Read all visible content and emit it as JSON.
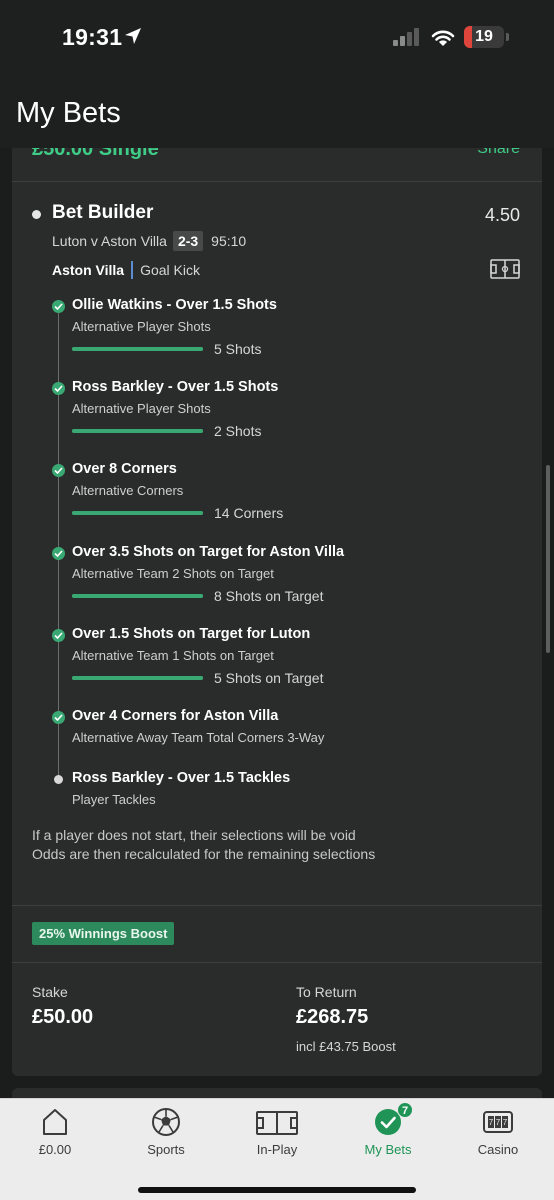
{
  "status": {
    "time": "19:31",
    "battery": "19"
  },
  "header": {
    "title": "My Bets"
  },
  "bet": {
    "type_label": "£50.00  Single",
    "share_label": "Share",
    "builder_title": "Bet Builder",
    "odds": "4.50",
    "match": "Luton v Aston Villa",
    "score": "2-3",
    "clock": "95:10",
    "event_team": "Aston Villa",
    "event_text": "Goal Kick",
    "selections": [
      {
        "title": "Ollie Watkins - Over 1.5 Shots",
        "sub": "Alternative Player Shots",
        "progress_label": "5 Shots",
        "progress": 1.0,
        "status": "won"
      },
      {
        "title": "Ross Barkley - Over 1.5 Shots",
        "sub": "Alternative Player Shots",
        "progress_label": "2 Shots",
        "progress": 1.0,
        "status": "won"
      },
      {
        "title": "Over 8 Corners",
        "sub": "Alternative Corners",
        "progress_label": "14 Corners",
        "progress": 1.0,
        "status": "won"
      },
      {
        "title": "Over 3.5 Shots on Target for Aston Villa",
        "sub": "Alternative Team 2 Shots on Target",
        "progress_label": "8 Shots on Target",
        "progress": 1.0,
        "status": "won"
      },
      {
        "title": "Over 1.5 Shots on Target for Luton",
        "sub": "Alternative Team 1 Shots on Target",
        "progress_label": "5 Shots on Target",
        "progress": 1.0,
        "status": "won"
      },
      {
        "title": "Over 4 Corners for Aston Villa",
        "sub": "Alternative Away Team Total Corners 3-Way",
        "status": "won"
      },
      {
        "title": "Ross Barkley - Over 1.5 Tackles",
        "sub": "Player Tackles",
        "status": "pending"
      }
    ],
    "void_note_1": "If a player does not start, their selections will be void",
    "void_note_2": "Odds are then recalculated for the remaining selections",
    "boost_label": "25% Winnings Boost",
    "stake_label": "Stake",
    "stake_value": "£50.00",
    "return_label": "To Return",
    "return_value": "£268.75",
    "boost_incl": "incl £43.75 Boost"
  },
  "nav": {
    "items": [
      {
        "label": "£0.00",
        "icon": "home-icon"
      },
      {
        "label": "Sports",
        "icon": "football-icon"
      },
      {
        "label": "In-Play",
        "icon": "pitch-icon"
      },
      {
        "label": "My Bets",
        "icon": "check-icon",
        "badge": "7",
        "active": true
      },
      {
        "label": "Casino",
        "icon": "slot-machine-icon"
      }
    ]
  },
  "colors": {
    "accent": "#3fcc87",
    "progress": "#3aa873",
    "nav_active": "#1f9456",
    "card": "#2a2c2b",
    "background": "#1b1d1c"
  }
}
